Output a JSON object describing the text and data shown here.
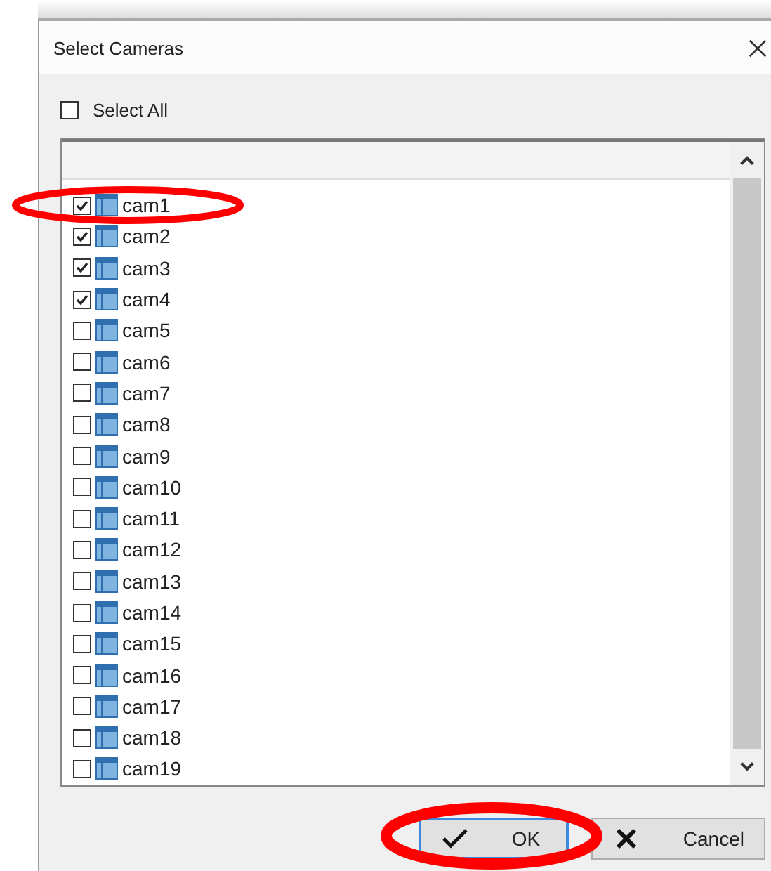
{
  "window": {
    "title": "Select Cameras"
  },
  "select_all": {
    "label": "Select All",
    "checked": false
  },
  "cameras": [
    {
      "name": "cam1",
      "checked": true
    },
    {
      "name": "cam2",
      "checked": true
    },
    {
      "name": "cam3",
      "checked": true
    },
    {
      "name": "cam4",
      "checked": true
    },
    {
      "name": "cam5",
      "checked": false
    },
    {
      "name": "cam6",
      "checked": false
    },
    {
      "name": "cam7",
      "checked": false
    },
    {
      "name": "cam8",
      "checked": false
    },
    {
      "name": "cam9",
      "checked": false
    },
    {
      "name": "cam10",
      "checked": false
    },
    {
      "name": "cam11",
      "checked": false
    },
    {
      "name": "cam12",
      "checked": false
    },
    {
      "name": "cam13",
      "checked": false
    },
    {
      "name": "cam14",
      "checked": false
    },
    {
      "name": "cam15",
      "checked": false
    },
    {
      "name": "cam16",
      "checked": false
    },
    {
      "name": "cam17",
      "checked": false
    },
    {
      "name": "cam18",
      "checked": false
    },
    {
      "name": "cam19",
      "checked": false
    }
  ],
  "buttons": [
    {
      "label": "OK",
      "kind": "ok",
      "selected": true
    },
    {
      "label": "Cancel",
      "kind": "cancel",
      "selected": false
    }
  ]
}
